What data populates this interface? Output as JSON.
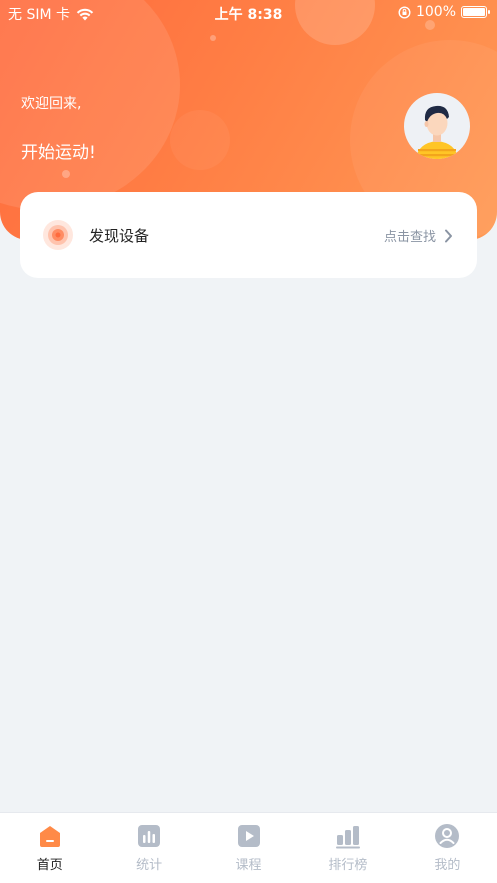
{
  "status_bar": {
    "carrier": "无 SIM 卡",
    "time": "上午 8:38",
    "battery": "100%"
  },
  "header": {
    "greeting": "欢迎回来,",
    "motto": "开始运动!"
  },
  "device_card": {
    "title": "发现设备",
    "action": "点击查找"
  },
  "tabs": [
    {
      "label": "首页",
      "icon": "home-icon",
      "active": true
    },
    {
      "label": "统计",
      "icon": "stats-icon",
      "active": false
    },
    {
      "label": "课程",
      "icon": "play-icon",
      "active": false
    },
    {
      "label": "排行榜",
      "icon": "ranking-icon",
      "active": false
    },
    {
      "label": "我的",
      "icon": "profile-icon",
      "active": false
    }
  ],
  "colors": {
    "accent": "#ff7a45",
    "tab_inactive": "#b4bcc8",
    "background": "#f0f3f6"
  }
}
